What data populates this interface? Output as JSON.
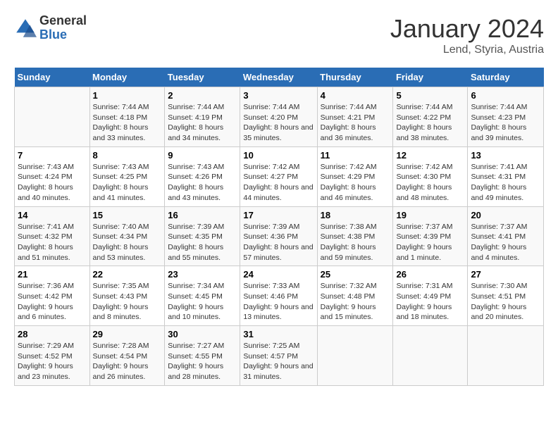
{
  "header": {
    "logo_general": "General",
    "logo_blue": "Blue",
    "month_title": "January 2024",
    "subtitle": "Lend, Styria, Austria"
  },
  "weekdays": [
    "Sunday",
    "Monday",
    "Tuesday",
    "Wednesday",
    "Thursday",
    "Friday",
    "Saturday"
  ],
  "weeks": [
    [
      {
        "day": "",
        "sunrise": "",
        "sunset": "",
        "daylight": ""
      },
      {
        "day": "1",
        "sunrise": "Sunrise: 7:44 AM",
        "sunset": "Sunset: 4:18 PM",
        "daylight": "Daylight: 8 hours and 33 minutes."
      },
      {
        "day": "2",
        "sunrise": "Sunrise: 7:44 AM",
        "sunset": "Sunset: 4:19 PM",
        "daylight": "Daylight: 8 hours and 34 minutes."
      },
      {
        "day": "3",
        "sunrise": "Sunrise: 7:44 AM",
        "sunset": "Sunset: 4:20 PM",
        "daylight": "Daylight: 8 hours and 35 minutes."
      },
      {
        "day": "4",
        "sunrise": "Sunrise: 7:44 AM",
        "sunset": "Sunset: 4:21 PM",
        "daylight": "Daylight: 8 hours and 36 minutes."
      },
      {
        "day": "5",
        "sunrise": "Sunrise: 7:44 AM",
        "sunset": "Sunset: 4:22 PM",
        "daylight": "Daylight: 8 hours and 38 minutes."
      },
      {
        "day": "6",
        "sunrise": "Sunrise: 7:44 AM",
        "sunset": "Sunset: 4:23 PM",
        "daylight": "Daylight: 8 hours and 39 minutes."
      }
    ],
    [
      {
        "day": "7",
        "sunrise": "Sunrise: 7:43 AM",
        "sunset": "Sunset: 4:24 PM",
        "daylight": "Daylight: 8 hours and 40 minutes."
      },
      {
        "day": "8",
        "sunrise": "Sunrise: 7:43 AM",
        "sunset": "Sunset: 4:25 PM",
        "daylight": "Daylight: 8 hours and 41 minutes."
      },
      {
        "day": "9",
        "sunrise": "Sunrise: 7:43 AM",
        "sunset": "Sunset: 4:26 PM",
        "daylight": "Daylight: 8 hours and 43 minutes."
      },
      {
        "day": "10",
        "sunrise": "Sunrise: 7:42 AM",
        "sunset": "Sunset: 4:27 PM",
        "daylight": "Daylight: 8 hours and 44 minutes."
      },
      {
        "day": "11",
        "sunrise": "Sunrise: 7:42 AM",
        "sunset": "Sunset: 4:29 PM",
        "daylight": "Daylight: 8 hours and 46 minutes."
      },
      {
        "day": "12",
        "sunrise": "Sunrise: 7:42 AM",
        "sunset": "Sunset: 4:30 PM",
        "daylight": "Daylight: 8 hours and 48 minutes."
      },
      {
        "day": "13",
        "sunrise": "Sunrise: 7:41 AM",
        "sunset": "Sunset: 4:31 PM",
        "daylight": "Daylight: 8 hours and 49 minutes."
      }
    ],
    [
      {
        "day": "14",
        "sunrise": "Sunrise: 7:41 AM",
        "sunset": "Sunset: 4:32 PM",
        "daylight": "Daylight: 8 hours and 51 minutes."
      },
      {
        "day": "15",
        "sunrise": "Sunrise: 7:40 AM",
        "sunset": "Sunset: 4:34 PM",
        "daylight": "Daylight: 8 hours and 53 minutes."
      },
      {
        "day": "16",
        "sunrise": "Sunrise: 7:39 AM",
        "sunset": "Sunset: 4:35 PM",
        "daylight": "Daylight: 8 hours and 55 minutes."
      },
      {
        "day": "17",
        "sunrise": "Sunrise: 7:39 AM",
        "sunset": "Sunset: 4:36 PM",
        "daylight": "Daylight: 8 hours and 57 minutes."
      },
      {
        "day": "18",
        "sunrise": "Sunrise: 7:38 AM",
        "sunset": "Sunset: 4:38 PM",
        "daylight": "Daylight: 8 hours and 59 minutes."
      },
      {
        "day": "19",
        "sunrise": "Sunrise: 7:37 AM",
        "sunset": "Sunset: 4:39 PM",
        "daylight": "Daylight: 9 hours and 1 minute."
      },
      {
        "day": "20",
        "sunrise": "Sunrise: 7:37 AM",
        "sunset": "Sunset: 4:41 PM",
        "daylight": "Daylight: 9 hours and 4 minutes."
      }
    ],
    [
      {
        "day": "21",
        "sunrise": "Sunrise: 7:36 AM",
        "sunset": "Sunset: 4:42 PM",
        "daylight": "Daylight: 9 hours and 6 minutes."
      },
      {
        "day": "22",
        "sunrise": "Sunrise: 7:35 AM",
        "sunset": "Sunset: 4:43 PM",
        "daylight": "Daylight: 9 hours and 8 minutes."
      },
      {
        "day": "23",
        "sunrise": "Sunrise: 7:34 AM",
        "sunset": "Sunset: 4:45 PM",
        "daylight": "Daylight: 9 hours and 10 minutes."
      },
      {
        "day": "24",
        "sunrise": "Sunrise: 7:33 AM",
        "sunset": "Sunset: 4:46 PM",
        "daylight": "Daylight: 9 hours and 13 minutes."
      },
      {
        "day": "25",
        "sunrise": "Sunrise: 7:32 AM",
        "sunset": "Sunset: 4:48 PM",
        "daylight": "Daylight: 9 hours and 15 minutes."
      },
      {
        "day": "26",
        "sunrise": "Sunrise: 7:31 AM",
        "sunset": "Sunset: 4:49 PM",
        "daylight": "Daylight: 9 hours and 18 minutes."
      },
      {
        "day": "27",
        "sunrise": "Sunrise: 7:30 AM",
        "sunset": "Sunset: 4:51 PM",
        "daylight": "Daylight: 9 hours and 20 minutes."
      }
    ],
    [
      {
        "day": "28",
        "sunrise": "Sunrise: 7:29 AM",
        "sunset": "Sunset: 4:52 PM",
        "daylight": "Daylight: 9 hours and 23 minutes."
      },
      {
        "day": "29",
        "sunrise": "Sunrise: 7:28 AM",
        "sunset": "Sunset: 4:54 PM",
        "daylight": "Daylight: 9 hours and 26 minutes."
      },
      {
        "day": "30",
        "sunrise": "Sunrise: 7:27 AM",
        "sunset": "Sunset: 4:55 PM",
        "daylight": "Daylight: 9 hours and 28 minutes."
      },
      {
        "day": "31",
        "sunrise": "Sunrise: 7:25 AM",
        "sunset": "Sunset: 4:57 PM",
        "daylight": "Daylight: 9 hours and 31 minutes."
      },
      {
        "day": "",
        "sunrise": "",
        "sunset": "",
        "daylight": ""
      },
      {
        "day": "",
        "sunrise": "",
        "sunset": "",
        "daylight": ""
      },
      {
        "day": "",
        "sunrise": "",
        "sunset": "",
        "daylight": ""
      }
    ]
  ]
}
